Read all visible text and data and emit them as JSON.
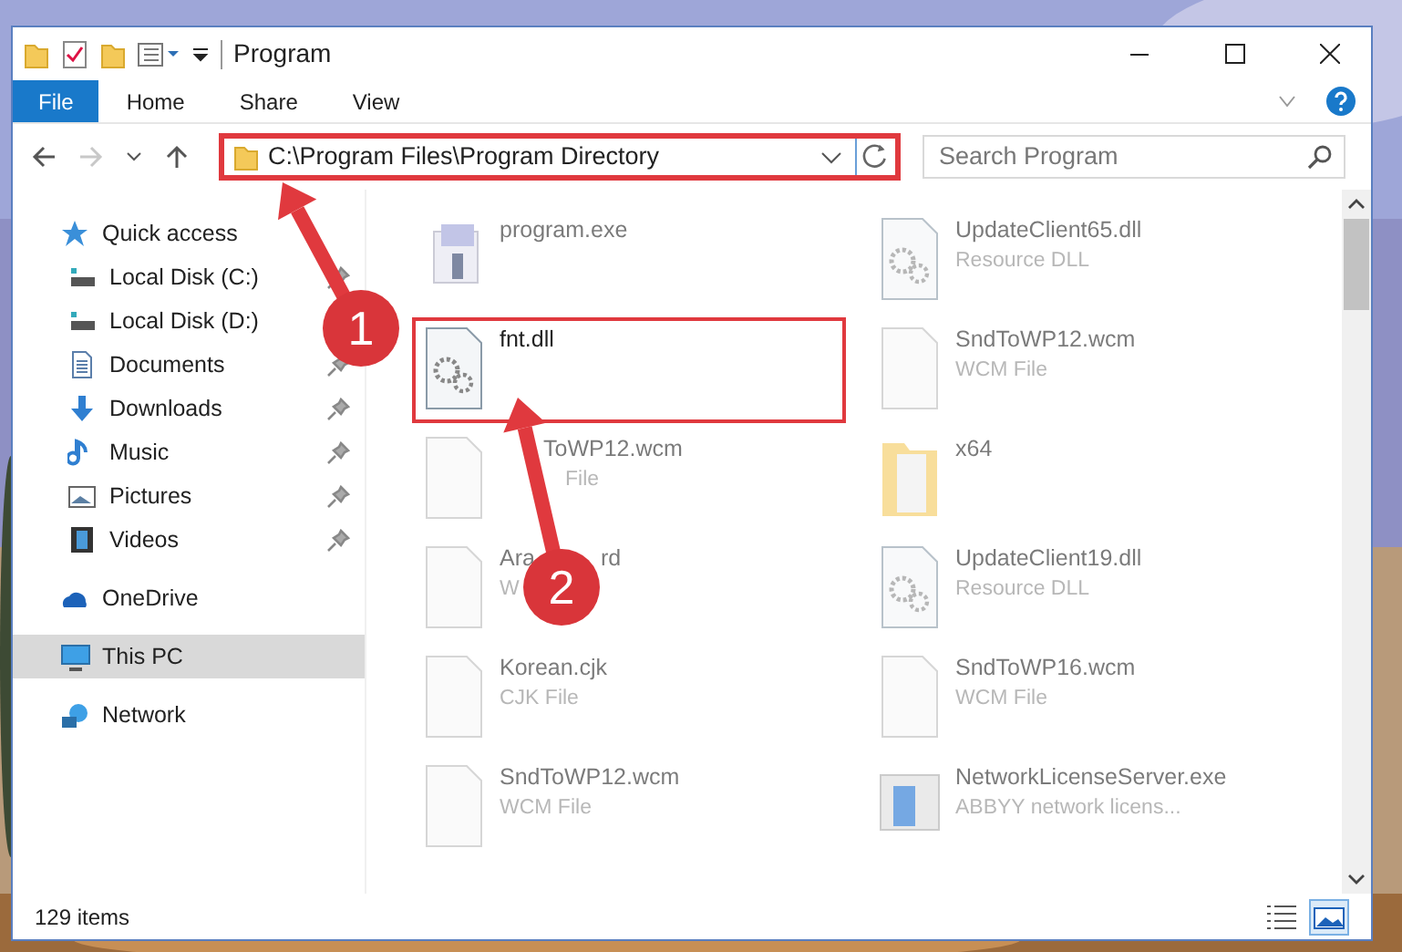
{
  "window": {
    "title": "Program"
  },
  "ribbon_tabs": [
    {
      "label": "File",
      "selected": true
    },
    {
      "label": "Home",
      "selected": false
    },
    {
      "label": "Share",
      "selected": false
    },
    {
      "label": "View",
      "selected": false
    }
  ],
  "nav": {
    "back_disabled": false,
    "forward_disabled": true
  },
  "address": {
    "value": "C:\\Program Files\\Program Directory",
    "highlighted": true
  },
  "search": {
    "placeholder": "Search Program"
  },
  "sidebar": {
    "items": [
      {
        "label": "Quick access",
        "kind": "star",
        "selected": false,
        "children": [
          {
            "label": "Local Disk (C:)",
            "kind": "drive",
            "pinned": true,
            "selected": false
          },
          {
            "label": "Local Disk (D:)",
            "kind": "drive",
            "pinned": false,
            "selected": false
          },
          {
            "label": "Documents",
            "kind": "document",
            "pinned": true,
            "selected": false
          },
          {
            "label": "Downloads",
            "kind": "download",
            "pinned": true,
            "selected": false
          },
          {
            "label": "Music",
            "kind": "music",
            "pinned": true,
            "selected": false
          },
          {
            "label": "Pictures",
            "kind": "picture",
            "pinned": true,
            "selected": false
          },
          {
            "label": "Videos",
            "kind": "video",
            "pinned": true,
            "selected": false
          }
        ]
      },
      {
        "label": "OneDrive",
        "kind": "cloud",
        "selected": false
      },
      {
        "label": "This PC",
        "kind": "pc",
        "selected": true
      },
      {
        "label": "Network",
        "kind": "network",
        "selected": false
      }
    ]
  },
  "files": [
    {
      "name": [
        "program.exe"
      ],
      "kind": "exe",
      "highlighted": false
    },
    {
      "name": [
        "UpdateClient65.dll"
      ],
      "type": [
        "Resource DLL"
      ],
      "kind": "dll",
      "highlighted": false
    },
    {
      "name": [
        "fnt.dll"
      ],
      "kind": "dll",
      "highlighted": true
    },
    {
      "name": [
        "SndToWP12.wcm"
      ],
      "type": [
        "WCM File"
      ],
      "kind": "file",
      "highlighted": false
    },
    {
      "name": [
        "ToWP12.wcm"
      ],
      "type": [
        "File"
      ],
      "kind": "file",
      "highlighted": false
    },
    {
      "name": [
        "x64"
      ],
      "kind": "folder",
      "highlighted": false
    },
    {
      "name": [
        "Ara",
        "rd"
      ],
      "type": [
        "W"
      ],
      "kind": "file",
      "highlighted": false
    },
    {
      "name": [
        "UpdateClient19.dll"
      ],
      "type": [
        "Resource DLL"
      ],
      "kind": "dll",
      "highlighted": false
    },
    {
      "name": [
        "Korean.cjk"
      ],
      "type": [
        "CJK File"
      ],
      "kind": "file",
      "highlighted": false
    },
    {
      "name": [
        "SndToWP16.wcm"
      ],
      "type": [
        "WCM File"
      ],
      "kind": "file",
      "highlighted": false
    },
    {
      "name": [
        "SndToWP12.wcm"
      ],
      "type": [
        "WCM File"
      ],
      "kind": "file",
      "highlighted": false
    },
    {
      "name": [
        "NetworkLicenseServer.exe"
      ],
      "type": [
        "ABBYY network licens..."
      ],
      "kind": "app",
      "highlighted": false
    }
  ],
  "status_bar": {
    "count": "129 items",
    "views": [
      {
        "selected": false
      },
      {
        "selected": true
      }
    ]
  },
  "annotations": [
    {
      "label": "1"
    },
    {
      "label": "2"
    }
  ]
}
